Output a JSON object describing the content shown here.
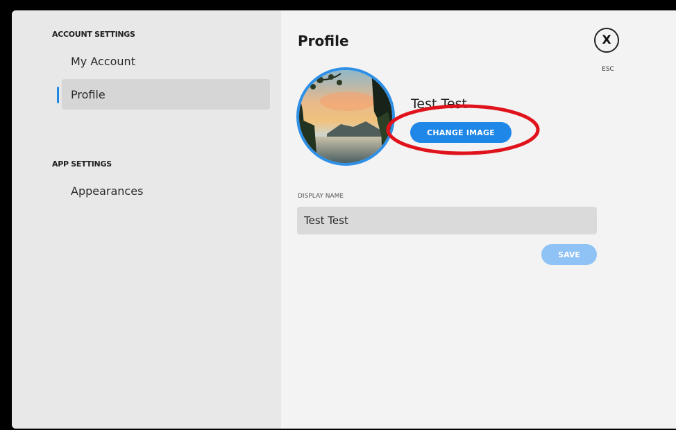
{
  "sidebar": {
    "account_header": "ACCOUNT SETTINGS",
    "account_items": [
      {
        "label": "My Account",
        "active": false
      },
      {
        "label": "Profile",
        "active": true
      }
    ],
    "app_header": "APP SETTINGS",
    "app_items": [
      {
        "label": "Appearances",
        "active": false
      }
    ]
  },
  "main": {
    "title": "Profile",
    "close": {
      "glyph": "X",
      "hint": "ESC"
    },
    "profile": {
      "username": "Test Test",
      "change_image_label": "CHANGE IMAGE"
    },
    "display_name": {
      "label": "DISPLAY NAME",
      "value": "Test Test"
    },
    "save_label": "SAVE"
  },
  "colors": {
    "accent": "#1f87e8",
    "accent_disabled": "#8fc3f5",
    "highlight_annotation": "#e0121b",
    "sidebar_bg": "#e8e8e8",
    "main_bg": "#f3f3f3"
  }
}
